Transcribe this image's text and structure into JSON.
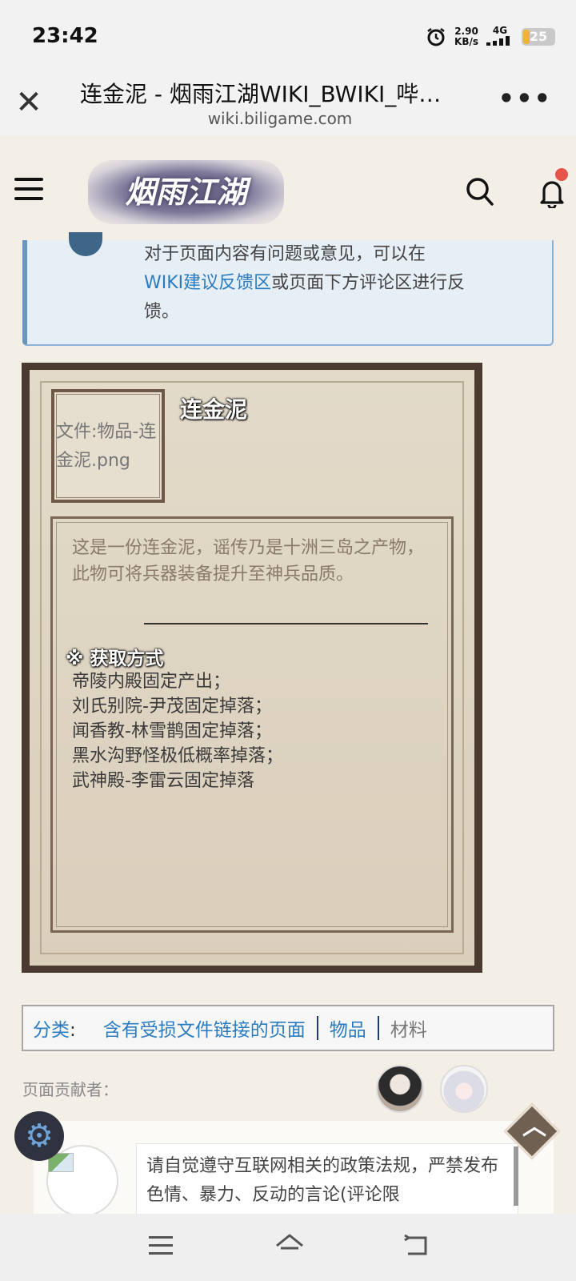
{
  "status_bar": {
    "time": "23:42",
    "net_speed_value": "2.90",
    "net_speed_unit": "KB/s",
    "network": "4G",
    "battery": "25"
  },
  "browser": {
    "title": "连金泥 - 烟雨江湖WIKI_BWIKI_哔…",
    "url": "wiki.biligame.com"
  },
  "site": {
    "logo_text": "烟雨江湖",
    "notification_dot_color": "#e5534b"
  },
  "notice": {
    "line_prefix": "对于页面内容有问题或意见，可以在",
    "link_text": "WIKI建议反馈区",
    "line_suffix": "或页面下方评论区进行反馈。"
  },
  "item": {
    "name": "连金泥",
    "image_alt": "文件:物品-连金泥.png",
    "description": "这是一份连金泥，谣传乃是十洲三岛之产物，此物可将兵器装备提升至神兵品质。",
    "obtain_heading": "※ 获取方式",
    "obtain_methods": [
      "帝陵内殿固定产出；",
      "刘氏别院-尹茂固定掉落；",
      "闻香教-林雪鹊固定掉落；",
      "黑水沟野怪极低概率掉落；",
      "武神殿-李雷云固定掉落"
    ]
  },
  "categories": {
    "label": "分类",
    "colon": ":",
    "items": [
      "含有受损文件链接的页面",
      "物品",
      "材料"
    ]
  },
  "contributors": {
    "label": "页面贡献者："
  },
  "comment": {
    "rules_text": "请自觉遵守互联网相关的政策法规，严禁发布色情、暴力、反动的言论(评论限"
  },
  "icons": {
    "close": "close-icon",
    "more": "more-icon",
    "menu": "hamburger-menu-icon",
    "search": "search-icon",
    "bell": "bell-icon",
    "settings": "gear-icon",
    "scroll_top": "chevron-up-icon"
  }
}
